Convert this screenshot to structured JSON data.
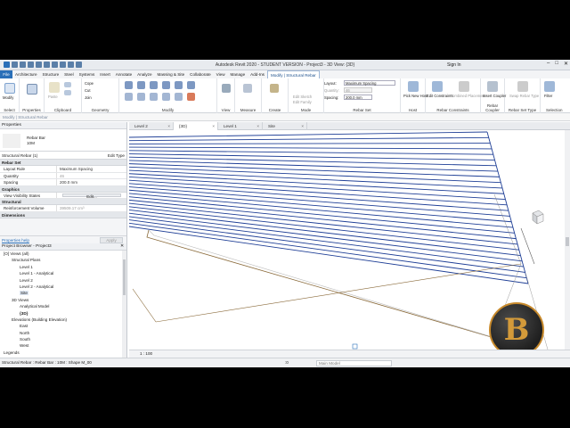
{
  "app": {
    "title": "Autodesk Revit 2020 - STUDENT VERSION - Project3 - 3D View: {3D}",
    "signin": "Sign In",
    "modify_bar": "Modify | Structural Rebar"
  },
  "ribbon_tabs": [
    "File",
    "Architecture",
    "Structure",
    "Steel",
    "Systems",
    "Insert",
    "Annotate",
    "Analyze",
    "Massing & Site",
    "Collaborate",
    "View",
    "Manage",
    "Add-Ins",
    "Modify | Structural Rebar"
  ],
  "ribbon": {
    "modify_label": "Modify",
    "select": "Select",
    "properties": "Properties",
    "clipboard": "Clipboard",
    "paste": "Paste",
    "cope": "Cope",
    "cut": "Cut",
    "join": "Join",
    "geometry": "Geometry",
    "modify_panel": "Modify",
    "view_panel": "View",
    "measure": "Measure",
    "create": "Create",
    "mode": "Mode",
    "mode_items": [
      "Edit Sketch",
      "Edit Family"
    ],
    "layout_label": "Layout:",
    "layout_value": "Maximum Spacing",
    "quantity_label": "Quantity:",
    "quantity_value": "46",
    "spacing_label": "Spacing:",
    "spacing_value": "200.0 mm",
    "rebar_set": "Rebar Set",
    "pick_new_host": "Pick New Host",
    "host": "Host",
    "edit_constraints": "Edit Constraints",
    "combined_placement": "Combined Placement",
    "rebar_constraints": "Rebar Constraints",
    "insert_coupler": "Insert Coupler",
    "rebar_coupler": "Rebar Coupler",
    "swap_rebar_type": "Swap Rebar Type",
    "rebar_set_type": "Rebar Set Type",
    "filter": "Filter",
    "selection": "Selection"
  },
  "properties": {
    "header": "Properties",
    "type_name": "Rebar Bar",
    "type_sub": "10M",
    "selector": "Structural Rebar (1)",
    "edit_type": "Edit Type",
    "groups": {
      "rebar_set": "Rebar Set",
      "graphics": "Graphics",
      "structural": "Structural",
      "dimensions": "Dimensions"
    },
    "rows": {
      "layout_rule_k": "Layout Rule",
      "layout_rule_v": "Maximum Spacing",
      "quantity_k": "Quantity",
      "quantity_v": "46",
      "spacing_k": "Spacing",
      "spacing_v": "200.0 mm",
      "visibility_k": "View Visibility States",
      "visibility_v": "Edit...",
      "volume_k": "Reinforcement Volume",
      "volume_v": "39509.17 cm³"
    },
    "help": "Properties help",
    "apply": "Apply"
  },
  "browser": {
    "header": "Project Browser - Project3",
    "items": [
      {
        "t": "[O] Views (all)",
        "lvl": 0
      },
      {
        "t": "Structural Plans",
        "lvl": 1
      },
      {
        "t": "Level 1",
        "lvl": 2
      },
      {
        "t": "Level 1 - Analytical",
        "lvl": 2
      },
      {
        "t": "Level 2",
        "lvl": 2
      },
      {
        "t": "Level 2 - Analytical",
        "lvl": 2
      },
      {
        "t": "Site",
        "lvl": 2,
        "hl": true
      },
      {
        "t": "3D Views",
        "lvl": 1
      },
      {
        "t": "Analytical Model",
        "lvl": 2
      },
      {
        "t": "{3D}",
        "lvl": 2,
        "bold": true
      },
      {
        "t": "Elevations (Building Elevation)",
        "lvl": 1
      },
      {
        "t": "East",
        "lvl": 2
      },
      {
        "t": "North",
        "lvl": 2
      },
      {
        "t": "South",
        "lvl": 2
      },
      {
        "t": "West",
        "lvl": 2
      },
      {
        "t": "Legends",
        "lvl": 0
      }
    ]
  },
  "view_tabs": [
    "Level 2",
    "{3D}",
    "Level 1",
    "Site"
  ],
  "view_scale": "1 : 100",
  "status": {
    "text": "Structural Rebar : Rebar Bar : 10M : Shape M_00",
    "zero": ":0",
    "model": "Main Model"
  },
  "logo_text": "B",
  "colors": {
    "rebar": "#1f3f96",
    "accent": "#2a6fb8",
    "edge": "#8a6a3a"
  }
}
